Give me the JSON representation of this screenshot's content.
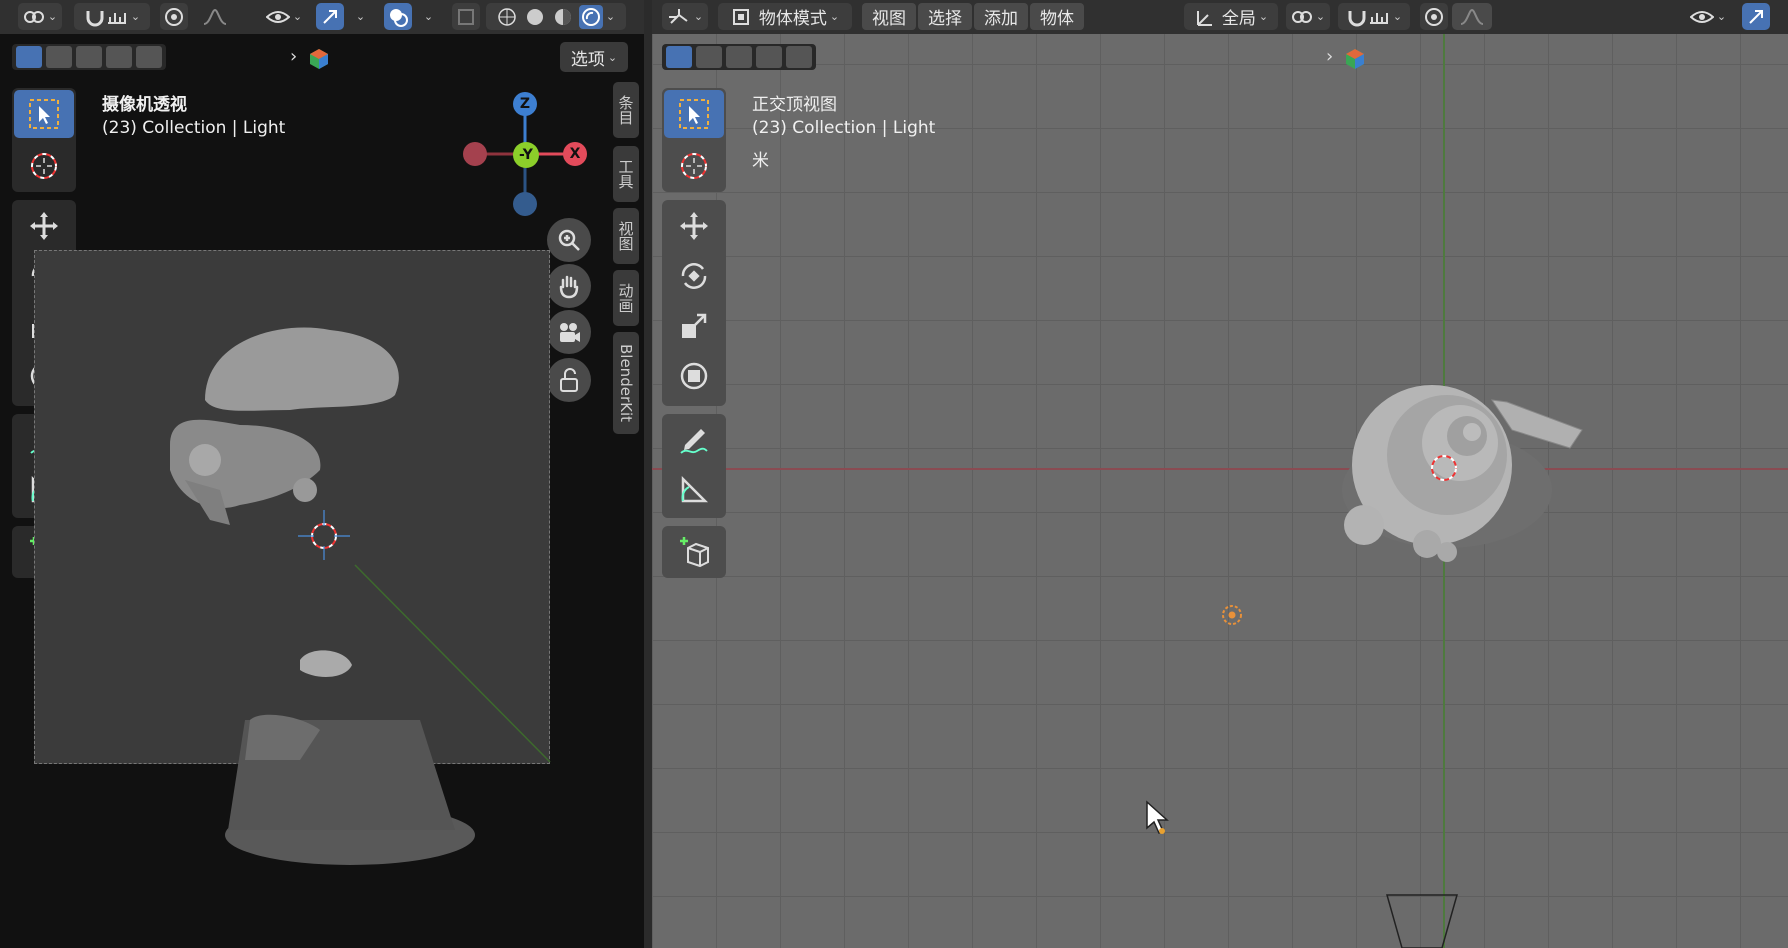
{
  "left_viewport": {
    "view_name": "摄像机透视",
    "collection_info": "(23) Collection | Light",
    "options_label": "选项",
    "gizmo": {
      "z": "Z",
      "x": "X",
      "neg_y": "-Y"
    },
    "side_tabs": [
      "条目",
      "工具",
      "视图",
      "动画",
      "BlenderKit"
    ]
  },
  "right_viewport": {
    "mode_label": "物体模式",
    "menus": [
      "视图",
      "选择",
      "添加",
      "物体"
    ],
    "transform_orientation": "全局",
    "view_name": "正交顶视图",
    "collection_info": "(23) Collection | Light",
    "unit_label": "米"
  },
  "colors": {
    "accent_blue": "#4772b3",
    "x_axis": "#e34b5b",
    "y_axis": "#8ccf2a",
    "z_axis": "#3d7fd1"
  }
}
